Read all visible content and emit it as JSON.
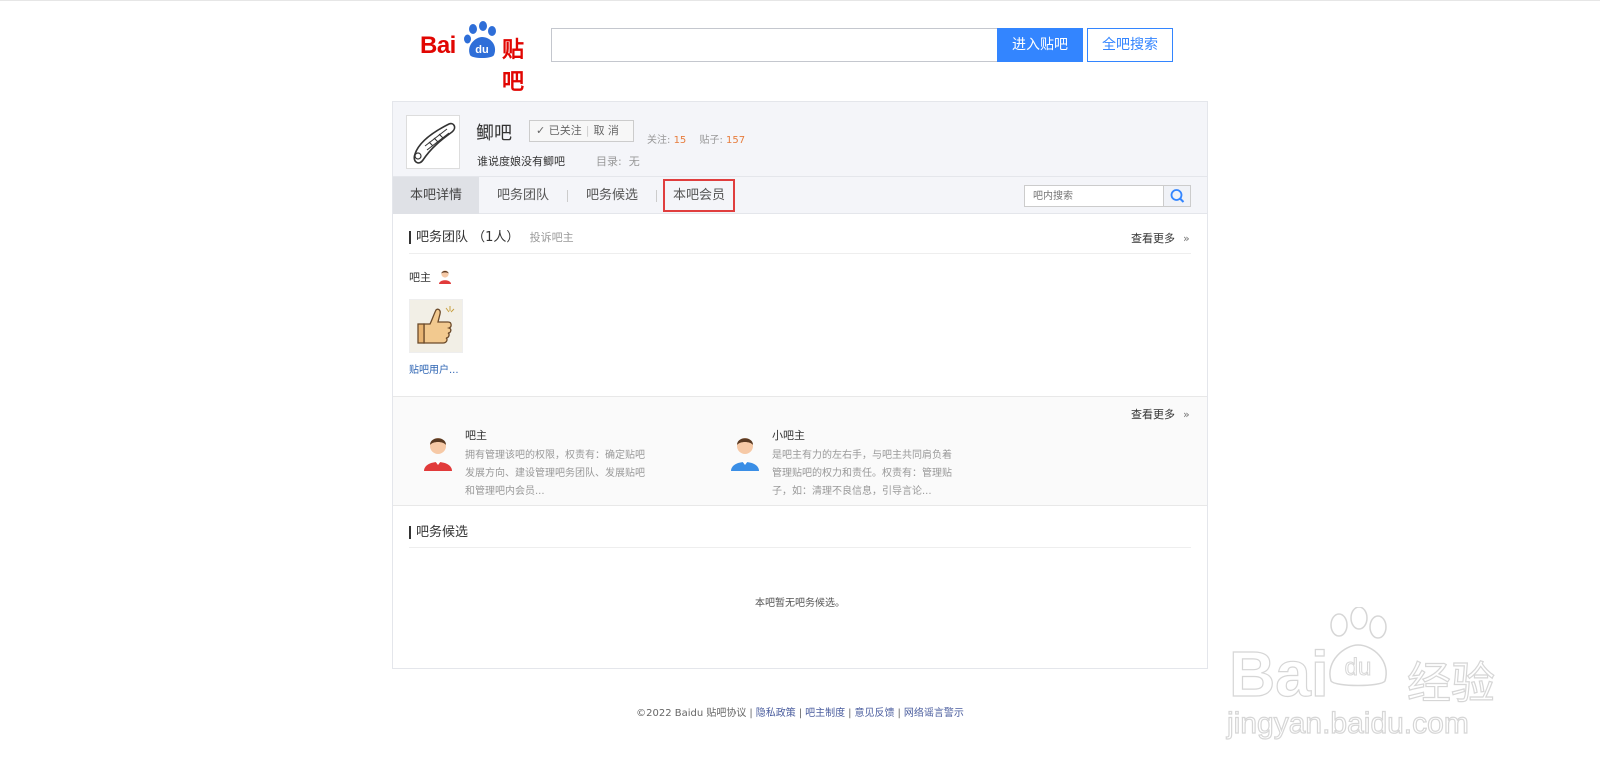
{
  "header": {
    "logo_bai": "Bai",
    "logo_tieba": "贴吧",
    "search_value": "",
    "enter_label": "进入贴吧",
    "all_search_label": "全吧搜索"
  },
  "forum": {
    "name": "鲫吧",
    "follow_label": "✓ 已关注",
    "unfollow_label": "取 消",
    "follow_count_label": "关注:",
    "follow_count": "15",
    "post_count_label": "贴子:",
    "post_count": "157",
    "slogan": "谁说度娘没有鲫吧",
    "catalog_label": "目录:",
    "catalog_value": "无"
  },
  "nav": {
    "tabs": [
      {
        "label": "本吧详情",
        "active": true
      },
      {
        "label": "吧务团队",
        "active": false
      },
      {
        "label": "吧务候选",
        "active": false
      },
      {
        "label": "本吧会员",
        "active": false,
        "highlighted": true
      }
    ],
    "search_placeholder": "吧内搜索"
  },
  "team": {
    "title": "吧务团队",
    "count": "（1人）",
    "complaint": "投诉吧主",
    "more": "查看更多",
    "more_arrow": "»",
    "role_label": "吧主",
    "member_name": "贴吧用户..."
  },
  "roles": {
    "more": "查看更多",
    "more_arrow": "»",
    "items": [
      {
        "title": "吧主",
        "desc": "拥有管理该吧的权限，权责有：确定贴吧发展方向、建设管理吧务团队、发展贴吧和管理吧内会员..."
      },
      {
        "title": "小吧主",
        "desc": "是吧主有力的左右手，与吧主共同肩负着管理贴吧的权力和责任。权责有：管理贴子，如：清理不良信息，引导言论..."
      }
    ]
  },
  "candidates": {
    "title": "吧务候选",
    "empty": "本吧暂无吧务候选。"
  },
  "footer": {
    "copyright": "©2022 Baidu",
    "links": [
      "贴吧协议",
      "隐私政策",
      "吧主制度",
      "意见反馈",
      "网络谣言警示"
    ]
  },
  "watermark": {
    "bai": "Bai",
    "du": "du",
    "jingyan": "经验",
    "url": "jingyan.baidu.com"
  },
  "colors": {
    "accent_blue": "#3385ff",
    "logo_red": "#e10602",
    "highlight_red": "#e03e3e",
    "count_orange": "#e77d3d"
  }
}
